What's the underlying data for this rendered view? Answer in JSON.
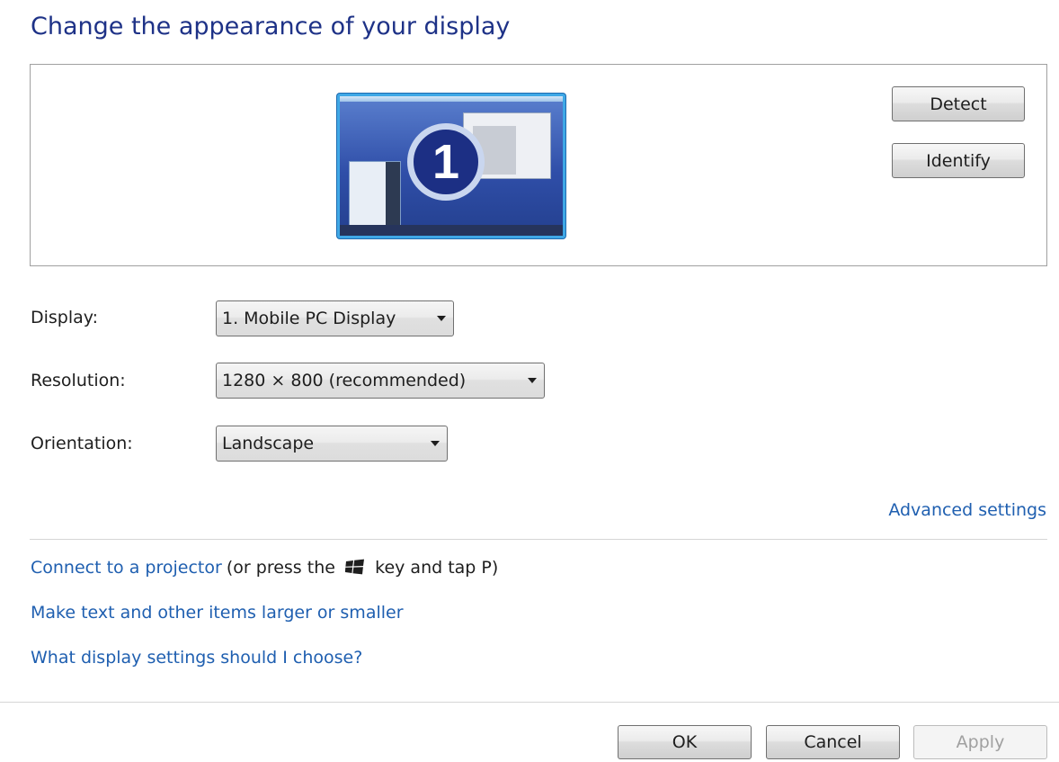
{
  "page": {
    "title": "Change the appearance of your display"
  },
  "preview": {
    "monitor_number": "1",
    "detect_label": "Detect",
    "identify_label": "Identify"
  },
  "settings": {
    "display_label": "Display:",
    "display_value": "1. Mobile PC Display",
    "resolution_label": "Resolution:",
    "resolution_value": "1280 × 800 (recommended)",
    "orientation_label": "Orientation:",
    "orientation_value": "Landscape"
  },
  "links": {
    "advanced_settings": "Advanced settings",
    "connect_projector": "Connect to a projector",
    "connect_projector_hint_before": "(or press the",
    "connect_projector_hint_after": "key and tap P)",
    "text_size": "Make text and other items larger or smaller",
    "help": "What display settings should I choose?"
  },
  "footer": {
    "ok_label": "OK",
    "cancel_label": "Cancel",
    "apply_label": "Apply"
  },
  "icons": {
    "windows_key": "windows-logo-icon",
    "dropdown_arrow": "chevron-down-icon"
  }
}
